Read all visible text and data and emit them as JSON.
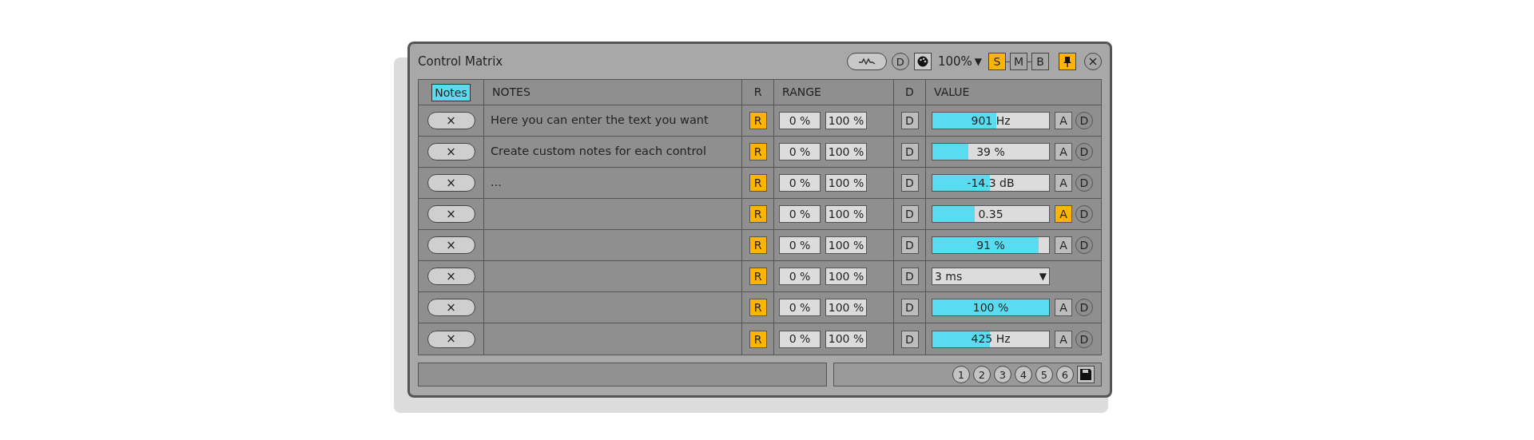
{
  "window": {
    "title": "Control Matrix",
    "zoom": "100%",
    "zoom_caret": "▼",
    "mode_buttons": [
      {
        "label": "S",
        "selected": true
      },
      {
        "label": "M",
        "selected": false
      },
      {
        "label": "B",
        "selected": false
      }
    ],
    "d_label": "D",
    "pinned": true,
    "close": "×"
  },
  "table": {
    "notes_toggle": {
      "label": "Notes",
      "on": true
    },
    "columns": [
      "NOTES",
      "R",
      "RANGE",
      "D",
      "VALUE"
    ],
    "rows": [
      {
        "remove": "×",
        "note": "Here you can enter the text you want",
        "r": {
          "label": "R",
          "on": true
        },
        "min": "0 %",
        "max": "100 %",
        "d": "D",
        "kind": "slider",
        "value": "901 Hz",
        "level": 0.55,
        "a": {
          "label": "A",
          "on": false
        },
        "reset": "D"
      },
      {
        "remove": "×",
        "note": "Create custom notes for each control",
        "r": {
          "label": "R",
          "on": true
        },
        "min": "0 %",
        "max": "100 %",
        "d": "D",
        "kind": "slider",
        "value": "39 %",
        "level": 0.31,
        "a": {
          "label": "A",
          "on": false
        },
        "reset": "D"
      },
      {
        "remove": "×",
        "note": "...",
        "r": {
          "label": "R",
          "on": true
        },
        "min": "0 %",
        "max": "100 %",
        "d": "D",
        "kind": "slider",
        "value": "-14.3 dB",
        "level": 0.49,
        "a": {
          "label": "A",
          "on": false
        },
        "reset": "D"
      },
      {
        "remove": "×",
        "r": {
          "label": "R",
          "on": true
        },
        "min": "0 %",
        "max": "100 %",
        "d": "D",
        "kind": "slider",
        "value": "0.35",
        "level": 0.36,
        "a": {
          "label": "A",
          "on": true
        },
        "reset": "D"
      },
      {
        "remove": "×",
        "r": {
          "label": "R",
          "on": true
        },
        "min": "0 %",
        "max": "100 %",
        "d": "D",
        "kind": "slider",
        "value": "91 %",
        "level": 0.91,
        "a": {
          "label": "A",
          "on": false
        },
        "reset": "D"
      },
      {
        "remove": "×",
        "r": {
          "label": "R",
          "on": true
        },
        "min": "0 %",
        "max": "100 %",
        "d": "D",
        "kind": "dropdown",
        "value": "3 ms",
        "caret": "▼"
      },
      {
        "remove": "×",
        "r": {
          "label": "R",
          "on": true
        },
        "min": "0 %",
        "max": "100 %",
        "d": "D",
        "kind": "slider",
        "value": "100 %",
        "level": 1,
        "a": {
          "label": "A",
          "on": false
        },
        "reset": "D"
      },
      {
        "remove": "×",
        "r": {
          "label": "R",
          "on": true
        },
        "min": "0 %",
        "max": "100 %",
        "d": "D",
        "kind": "slider",
        "value": "425 Hz",
        "level": 0.49,
        "a": {
          "label": "A",
          "on": false
        },
        "reset": "D"
      }
    ]
  },
  "presets": [
    "1",
    "2",
    "3",
    "4",
    "5",
    "6"
  ]
}
